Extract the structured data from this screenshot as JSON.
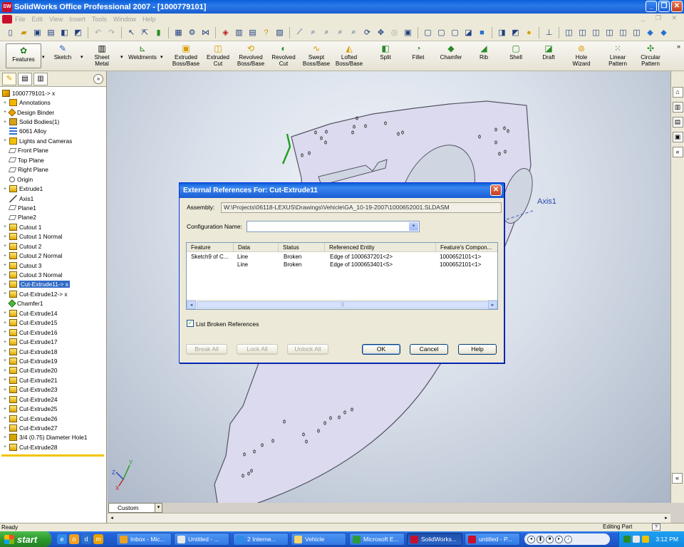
{
  "window": {
    "title": "SolidWorks Office Professional 2007 - [1000779101]",
    "buttons": [
      "_",
      "❐",
      "✕"
    ]
  },
  "menubar": {
    "items": [
      "File",
      "Edit",
      "View",
      "Insert",
      "Tools",
      "Window",
      "Help"
    ],
    "right": "_ ❐ ✕"
  },
  "command_manager": {
    "left": [
      {
        "label": "Features",
        "icon": "features-icon"
      },
      {
        "label": "Sketch",
        "icon": "sketch-icon"
      },
      {
        "label": "Sheet Metal",
        "icon": "sheet-metal-icon"
      },
      {
        "label": "Weldments",
        "icon": "weldments-icon"
      }
    ],
    "tools": [
      {
        "label": "Extruded Boss/Base",
        "icon": "extruded-boss-icon"
      },
      {
        "label": "Extruded Cut",
        "icon": "extruded-cut-icon"
      },
      {
        "label": "Revolved Boss/Base",
        "icon": "revolved-boss-icon"
      },
      {
        "label": "Revolved Cut",
        "icon": "revolved-cut-icon"
      },
      {
        "label": "Swept Boss/Base",
        "icon": "swept-boss-icon"
      },
      {
        "label": "Lofted Boss/Base",
        "icon": "lofted-boss-icon"
      },
      {
        "label": "Split",
        "icon": "split-icon"
      },
      {
        "label": "Fillet",
        "icon": "fillet-icon"
      },
      {
        "label": "Chamfer",
        "icon": "chamfer-icon"
      },
      {
        "label": "Rib",
        "icon": "rib-icon"
      },
      {
        "label": "Shell",
        "icon": "shell-icon"
      },
      {
        "label": "Draft",
        "icon": "draft-icon"
      },
      {
        "label": "Hole Wizard",
        "icon": "hole-wizard-icon"
      },
      {
        "label": "Linear Pattern",
        "icon": "linear-pattern-icon"
      },
      {
        "label": "Circular Pattern",
        "icon": "circular-pattern-icon"
      }
    ]
  },
  "feature_tree": {
    "nodes": [
      {
        "label": "1000779101-> x",
        "icon": "part"
      },
      {
        "label": "Annotations",
        "icon": "ann"
      },
      {
        "label": "Design Binder",
        "icon": "bind"
      },
      {
        "label": "Solid Bodies(1)",
        "icon": "body"
      },
      {
        "label": "6061 Alloy",
        "icon": "mat"
      },
      {
        "label": "Lights and Cameras",
        "icon": "light"
      },
      {
        "label": "Front Plane",
        "icon": "plane"
      },
      {
        "label": "Top Plane",
        "icon": "plane"
      },
      {
        "label": "Right Plane",
        "icon": "plane"
      },
      {
        "label": "Origin",
        "icon": "origin"
      },
      {
        "label": "Extrude1",
        "icon": "feat"
      },
      {
        "label": "Axis1",
        "icon": "axis"
      },
      {
        "label": "Plane1",
        "icon": "plane"
      },
      {
        "label": "Plane2",
        "icon": "plane"
      },
      {
        "label": "Cutout 1",
        "icon": "feat"
      },
      {
        "label": "Cutout 1 Normal",
        "icon": "feat"
      },
      {
        "label": "Cutout 2",
        "icon": "feat"
      },
      {
        "label": "Cutout 2 Normal",
        "icon": "feat"
      },
      {
        "label": "Cutout 3",
        "icon": "feat"
      },
      {
        "label": "Cutout 3 Normal",
        "icon": "feat"
      },
      {
        "label": "Cut-Extrude11-> x",
        "icon": "feat"
      },
      {
        "label": "Cut-Extrude12-> x",
        "icon": "feat"
      },
      {
        "label": "Chamfer1",
        "icon": "chamfer"
      },
      {
        "label": "Cut-Extrude14",
        "icon": "feat"
      },
      {
        "label": "Cut-Extrude15",
        "icon": "feat"
      },
      {
        "label": "Cut-Extrude16",
        "icon": "feat"
      },
      {
        "label": "Cut-Extrude17",
        "icon": "feat"
      },
      {
        "label": "Cut-Extrude18",
        "icon": "feat"
      },
      {
        "label": "Cut-Extrude19",
        "icon": "feat"
      },
      {
        "label": "Cut-Extrude20",
        "icon": "feat"
      },
      {
        "label": "Cut-Extrude21",
        "icon": "feat"
      },
      {
        "label": "Cut-Extrude23",
        "icon": "feat"
      },
      {
        "label": "Cut-Extrude24",
        "icon": "feat"
      },
      {
        "label": "Cut-Extrude25",
        "icon": "feat"
      },
      {
        "label": "Cut-Extrude26",
        "icon": "feat"
      },
      {
        "label": "Cut-Extrude27",
        "icon": "feat"
      },
      {
        "label": "3/4 (0.75) Diameter Hole1",
        "icon": "hole"
      },
      {
        "label": "Cut-Extrude28",
        "icon": "feat"
      }
    ]
  },
  "viewport": {
    "axis_label": "Axis1",
    "view_mode": "Custom"
  },
  "dialog": {
    "title": "External References For: Cut-Extrude11",
    "assembly_label": "Assembly:",
    "assembly_path": "W:\\Projects\\06118-LEXUS\\Drawings\\Vehicle\\GA_10-19-2007\\1000652001.SLDASM",
    "config_label": "Configuration Name:",
    "config_value": "",
    "columns": [
      "Feature",
      "Data",
      "Status",
      "Referenced Entity",
      "Feature's Compon..."
    ],
    "rows": [
      [
        "Sketch9 of C...",
        "Line",
        "Broken",
        "Edge of 1000637201<2>",
        "1000652101<1>"
      ],
      [
        "",
        "Line",
        "Broken",
        "Edge of 1000653401<5>",
        "1000652101<1>"
      ]
    ],
    "list_broken_label": "List Broken References",
    "list_broken_checked": true,
    "buttons": {
      "break_all": "Break All",
      "lock_all": "Lock All",
      "unlock_all": "Unlock All",
      "ok": "OK",
      "cancel": "Cancel",
      "help": "Help"
    }
  },
  "statusbar": {
    "left": "Ready",
    "right": "Editing Part",
    "help": "?"
  },
  "taskbar": {
    "start": "start",
    "items": [
      {
        "label": "Inbox - Mic...",
        "color": "#f0a020"
      },
      {
        "label": "Untitled - ...",
        "color": "#e8e8e8"
      },
      {
        "label": "2 Interne...",
        "color": "#2f8ae8"
      },
      {
        "label": "Vehicle",
        "color": "#f5d36a"
      },
      {
        "label": "Microsoft E...",
        "color": "#2e9a3c"
      },
      {
        "label": "SolidWorks...",
        "color": "#c8102e"
      },
      {
        "label": "untitled - P...",
        "color": "#c8102e"
      }
    ],
    "clock": "3:12 PM"
  },
  "colors": {
    "title_blue": "#0a5fd8",
    "selection": "#316ac5",
    "part_fill": "#d9d8ef",
    "sketch_green": "#20a020"
  }
}
